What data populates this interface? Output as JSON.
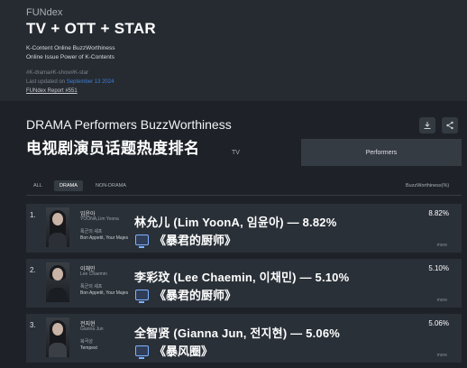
{
  "header": {
    "brand": "FUNdex",
    "title": "TV + OTT + STAR",
    "subtitle_1": "K-Content Online BuzzWorthiness",
    "subtitle_2": "Online Issue Power of K-Contents",
    "tags": "#K-drama#K-show#K-star",
    "updated_label": "Last updated on",
    "updated_date": "September 13 2024",
    "report_link": "FUNdex Report #551"
  },
  "section": {
    "title": "DRAMA Performers BuzzWorthiness",
    "title_zh": "电视剧演员话题热度排名",
    "tv_label": "TV",
    "download_icon": "download-icon",
    "share_icon": "share-icon",
    "performers_tab": "Performers"
  },
  "filters": {
    "all": "ALL",
    "drama": "DRAMA",
    "non_drama": "NON-DRAMA",
    "active": "DRAMA",
    "column_header": "BuzzWorthiness(%)"
  },
  "rows": [
    {
      "rank": "1.",
      "name_ko": "임윤아",
      "name_en": "YOONA,Lim Yoona",
      "role": "폭군의 셰프",
      "show": "Bon Appetit, Your Majes",
      "pct": "8.82%",
      "more": "more",
      "overlay_line1": "林允儿 (Lim YoonA, 임윤아) — 8.82%",
      "overlay_line2": "《暴君的厨师》"
    },
    {
      "rank": "2.",
      "name_ko": "이채민",
      "name_en": "Lee Chaemin",
      "role": "폭군의 셰프",
      "show": "Bon Appetit, Your Majes",
      "pct": "5.10%",
      "more": "more",
      "overlay_line1": "李彩玟 (Lee Chaemin, 이채민) — 5.10%",
      "overlay_line2": "《暴君的厨师》"
    },
    {
      "rank": "3.",
      "name_ko": "전지현",
      "name_en": "Gianna Jun",
      "role": "북극성",
      "show": "Tempest",
      "pct": "5.06%",
      "more": "more",
      "overlay_line1": "全智贤 (Gianna Jun, 전지현) — 5.06%",
      "overlay_line2": "《暴风圈》"
    }
  ]
}
